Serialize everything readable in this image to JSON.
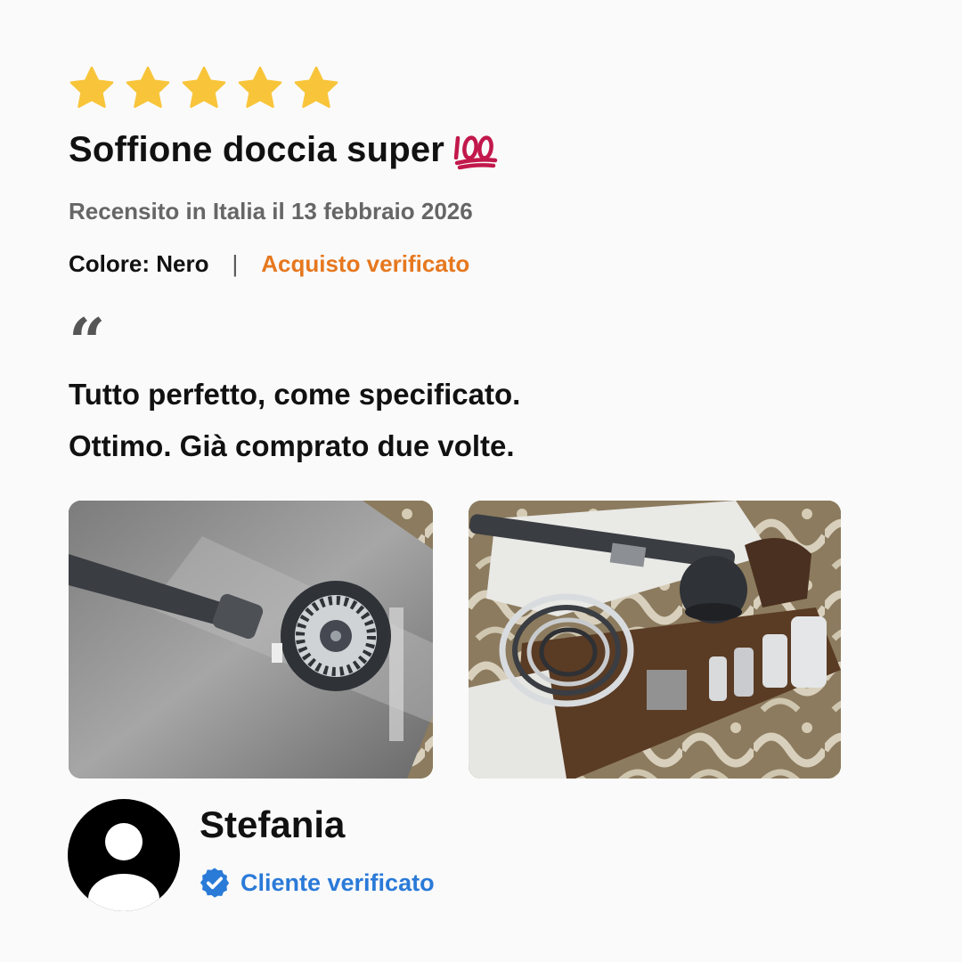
{
  "review": {
    "rating": 5,
    "rating_max": 5,
    "title": "Soffione doccia super",
    "title_emoji": "hundred-points-icon",
    "meta": "Recensito in Italia il 13 febbraio 2026",
    "color_label": "Colore: Nero",
    "separator": "|",
    "verified_purchase": "Acquisto verificato",
    "body_lines": [
      "Tutto perfetto, come specificato.",
      "Ottimo. Già comprato due volte."
    ]
  },
  "reviewer": {
    "name": "Stefania",
    "badge": "Cliente verificato"
  },
  "colors": {
    "star": "#f8c53a",
    "verified_purchase": "#e6781f",
    "badge": "#2a7ad8",
    "emoji": "#c2184b",
    "meta": "#666666"
  },
  "icons": {
    "star": "star-icon",
    "quote": "quote-icon",
    "avatar": "user-avatar-icon",
    "badge": "verified-check-icon"
  }
}
